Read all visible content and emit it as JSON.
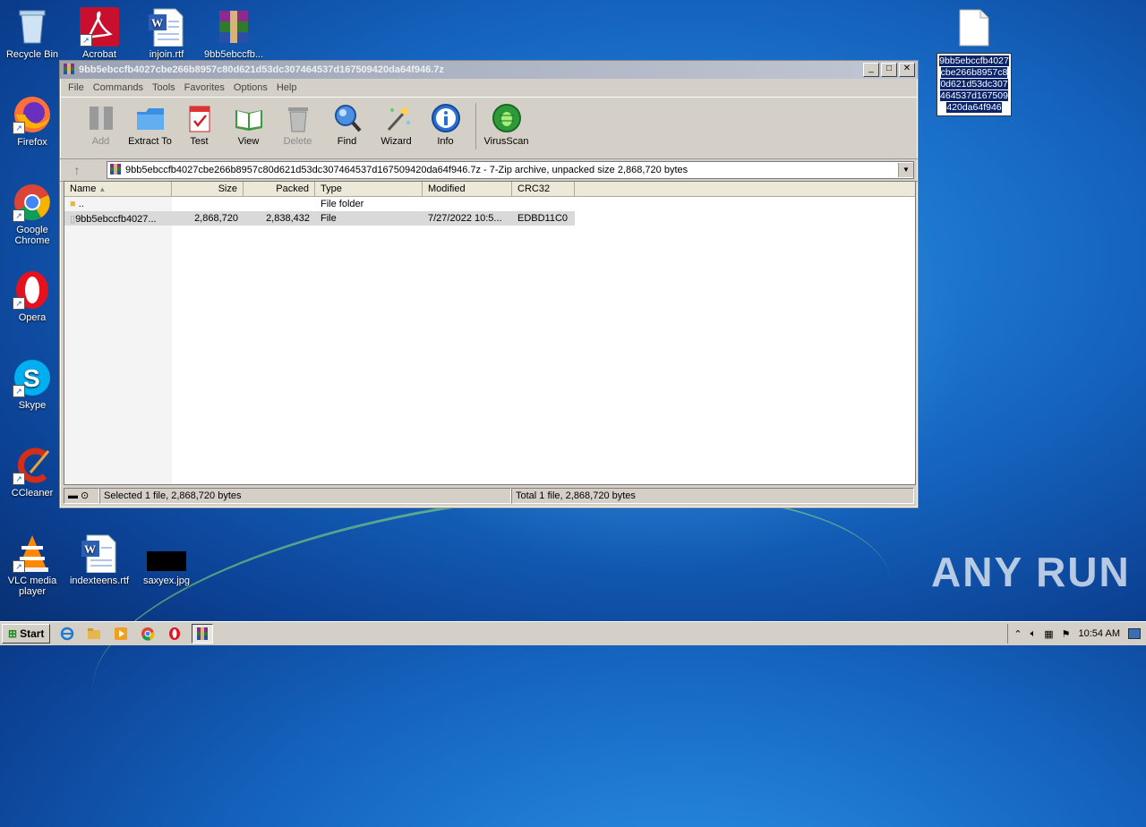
{
  "desktop": {
    "icons": [
      {
        "label": "Recycle Bin"
      },
      {
        "label": "Acrobat"
      },
      {
        "label": "injoin.rtf"
      },
      {
        "label": "9bb5ebccfb..."
      },
      {
        "label": "Firefox"
      },
      {
        "label": "Google Chrome"
      },
      {
        "label": "Opera"
      },
      {
        "label": "Skype"
      },
      {
        "label": "CCleaner"
      },
      {
        "label": "VLC media player"
      },
      {
        "label": "indexteens.rtf"
      },
      {
        "label": "saxyex.jpg"
      }
    ],
    "selected_file_label": "9bb5ebccfb4027cbe266b8957c80d621d53dc307464537d167509420da64f946"
  },
  "window": {
    "title": "9bb5ebccfb4027cbe266b8957c80d621d53dc307464537d167509420da64f946.7z",
    "menu": [
      "File",
      "Commands",
      "Tools",
      "Favorites",
      "Options",
      "Help"
    ],
    "toolbar": [
      {
        "label": "Add",
        "icon": "add-icon",
        "disabled": true
      },
      {
        "label": "Extract To",
        "icon": "extract-icon"
      },
      {
        "label": "Test",
        "icon": "test-icon"
      },
      {
        "label": "View",
        "icon": "view-icon"
      },
      {
        "label": "Delete",
        "icon": "delete-icon",
        "disabled": true
      },
      {
        "label": "Find",
        "icon": "find-icon"
      },
      {
        "label": "Wizard",
        "icon": "wizard-icon"
      },
      {
        "label": "Info",
        "icon": "info-icon"
      },
      {
        "label": "VirusScan",
        "icon": "virusscan-icon"
      }
    ],
    "address": "9bb5ebccfb4027cbe266b8957c80d621d53dc307464537d167509420da64f946.7z - 7-Zip archive, unpacked size 2,868,720 bytes",
    "columns": [
      "Name",
      "Size",
      "Packed",
      "Type",
      "Modified",
      "CRC32"
    ],
    "rows": [
      {
        "name": "..",
        "size": "",
        "packed": "",
        "type": "File folder",
        "modified": "",
        "crc": ""
      },
      {
        "name": "9bb5ebccfb4027...",
        "size": "2,868,720",
        "packed": "2,838,432",
        "type": "File",
        "modified": "7/27/2022 10:5...",
        "crc": "EDBD11C0"
      }
    ],
    "status_left": "Selected 1 file, 2,868,720 bytes",
    "status_right": "Total 1 file, 2,868,720 bytes"
  },
  "taskbar": {
    "start_label": "Start",
    "clock": "10:54 AM"
  },
  "watermark": "ANY RUN"
}
